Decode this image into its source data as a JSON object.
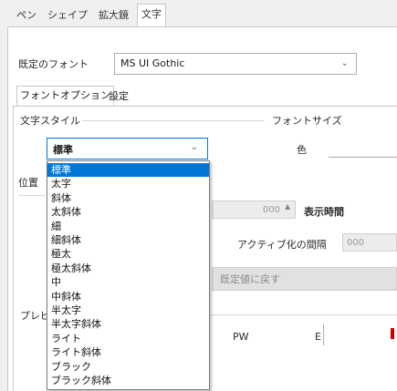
{
  "tabs": [
    {
      "label": "ペン"
    },
    {
      "label": "シェイプ"
    },
    {
      "label": "拡大鏡"
    },
    {
      "label": "文字"
    }
  ],
  "profile": {
    "label": "既定のフォント",
    "value": "MS UI Gothic"
  },
  "subtabs": [
    {
      "label": "フォントオプション"
    },
    {
      "label": "設定"
    }
  ],
  "font_style_label": "文字スタイル",
  "font_style_value": "標準",
  "right": {
    "size_label": "フォントサイズ",
    "color_label": "色"
  },
  "line_label": "位置",
  "numeric_box": "000",
  "spinner": "▲",
  "interval_label": "表示時間",
  "after_label": "アクティブ化の間隔",
  "after_value": "000",
  "button_label": "既定値に戻す",
  "lower_group_label": "プレビュー",
  "lower_text": "PW",
  "lower_text2": "E",
  "dropdown": {
    "items": [
      "標準",
      "太字",
      "斜体",
      "太斜体",
      "細",
      "細斜体",
      "極太",
      "極太斜体",
      "中",
      "中斜体",
      "半太字",
      "半太字斜体",
      "ライト",
      "ライト斜体",
      "ブラック",
      "ブラック斜体"
    ],
    "selected_index": 0
  },
  "colors": {
    "accent": "#0078d7",
    "red": "#d00000"
  }
}
